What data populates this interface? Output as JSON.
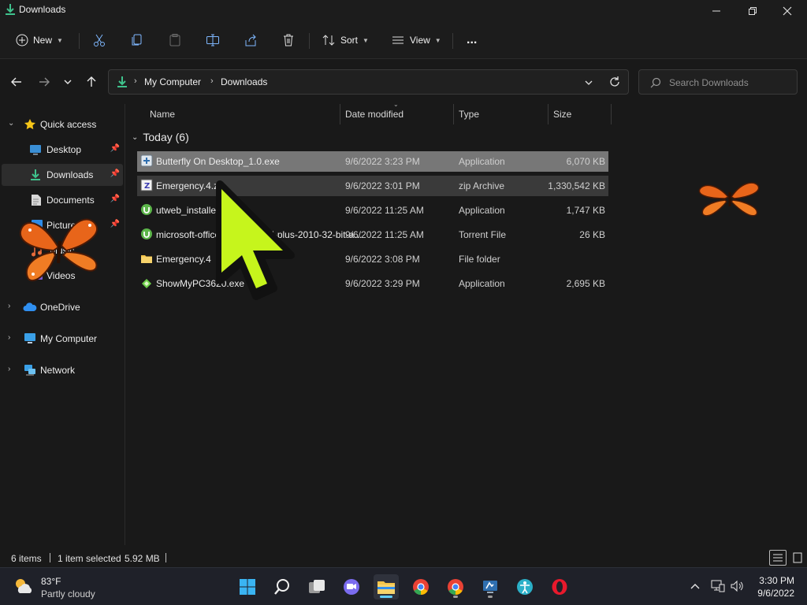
{
  "window": {
    "title": "Downloads"
  },
  "toolbar": {
    "new_label": "New",
    "sort_label": "Sort",
    "view_label": "View",
    "more_label": "..."
  },
  "address": {
    "crumbs": [
      "My Computer",
      "Downloads"
    ],
    "search_placeholder": "Search Downloads"
  },
  "sidebar": {
    "quick_access": "Quick access",
    "items": [
      {
        "label": "Desktop",
        "pinned": true
      },
      {
        "label": "Downloads",
        "pinned": true
      },
      {
        "label": "Documents",
        "pinned": true
      },
      {
        "label": "Pictures",
        "pinned": true
      },
      {
        "label": "Music",
        "pinned": false
      },
      {
        "label": "Videos",
        "pinned": false
      }
    ],
    "onedrive": "OneDrive",
    "my_computer": "My Computer",
    "network": "Network"
  },
  "columns": {
    "name": "Name",
    "date": "Date modified",
    "type": "Type",
    "size": "Size"
  },
  "group": {
    "label": "Today (6)"
  },
  "files": [
    {
      "name": "Butterfly On Desktop_1.0.exe",
      "date": "9/6/2022 3:23 PM",
      "type": "Application",
      "size": "6,070 KB",
      "icon": "installer-icon"
    },
    {
      "name": "Emergency.4.zip",
      "date": "9/6/2022 3:01 PM",
      "type": "zip Archive",
      "size": "1,330,542 KB",
      "icon": "zip-icon"
    },
    {
      "name": "utweb_installer.exe",
      "date": "9/6/2022 11:25 AM",
      "type": "Application",
      "size": "1,747 KB",
      "icon": "utorrent-icon"
    },
    {
      "name": "microsoft-office-professional-plus-2010-32-bit-a...",
      "date": "9/6/2022 11:25 AM",
      "type": "Torrent File",
      "size": "26 KB",
      "icon": "torrent-file-icon"
    },
    {
      "name": "Emergency.4",
      "date": "9/6/2022 3:08 PM",
      "type": "File folder",
      "size": "",
      "icon": "folder-icon"
    },
    {
      "name": "ShowMyPC3620.exe",
      "date": "9/6/2022 3:29 PM",
      "type": "Application",
      "size": "2,695 KB",
      "icon": "showmypc-icon"
    }
  ],
  "status": {
    "items": "6 items",
    "selected": "1 item selected",
    "selected_size": "5.92 MB"
  },
  "taskbar": {
    "weather_temp": "83°F",
    "weather_cond": "Partly cloudy",
    "time": "3:30 PM",
    "date": "9/6/2022"
  },
  "colors": {
    "accent": "#60cdff",
    "cursor": "#c6f51c",
    "butterfly": "#e8651a",
    "folder": "#f3c44a"
  }
}
